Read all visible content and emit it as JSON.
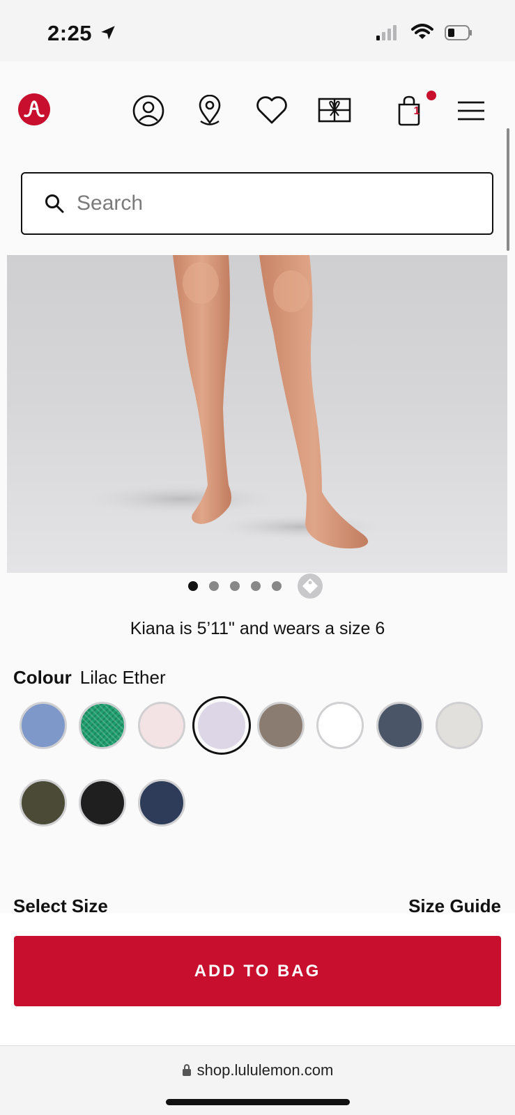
{
  "status": {
    "time": "2:25"
  },
  "header": {
    "icons": [
      "lululemon-logo",
      "account-icon",
      "store-locator-icon",
      "wishlist-heart-icon",
      "gift-card-icon",
      "shopping-bag-icon",
      "menu-icon"
    ],
    "bag_count": "1",
    "accent": "#c8102e"
  },
  "search": {
    "placeholder": "Search"
  },
  "carousel": {
    "total_dots": 5,
    "active_index": 0
  },
  "product": {
    "model_caption": "Kiana is 5’11\" and wears a size 6",
    "colour_label": "Colour",
    "colour_name": "Lilac Ether",
    "swatches": [
      {
        "color": "#7e98c9"
      },
      {
        "color": "#1e9e6e"
      },
      {
        "color": "#f4e3e4"
      },
      {
        "color": "#ddd6e6",
        "selected": true
      },
      {
        "color": "#8a7c70"
      },
      {
        "color": "#ffffff"
      },
      {
        "color": "#4a5668"
      },
      {
        "color": "#e2e0dc"
      },
      {
        "color": "#4a4a36"
      },
      {
        "color": "#1f1f1f"
      },
      {
        "color": "#2e3c5a"
      }
    ]
  },
  "size": {
    "select_label": "Select Size",
    "guide_label": "Size Guide"
  },
  "cta": {
    "add_to_bag": "ADD TO BAG"
  },
  "browser": {
    "url": "shop.lululemon.com"
  }
}
